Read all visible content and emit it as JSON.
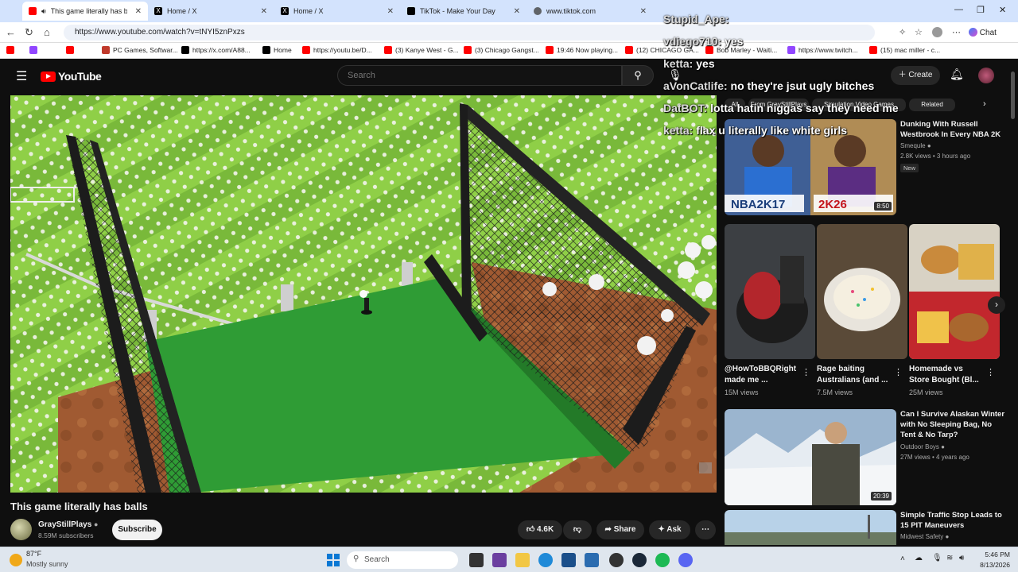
{
  "browser": {
    "tabs": [
      {
        "title": "This game literally has balls -",
        "icon": "youtube-icon",
        "active": true
      },
      {
        "title": "Home / X",
        "icon": "x-icon"
      },
      {
        "title": "Home / X",
        "icon": "x-icon"
      },
      {
        "title": "TikTok - Make Your Day",
        "icon": "tiktok-icon"
      },
      {
        "title": "www.tiktok.com",
        "icon": "globe-icon"
      }
    ],
    "url": "https://www.youtube.com/watch?v=tNYI5znPxzs",
    "chat_label": "Chat",
    "bookmarks": [
      {
        "label": "",
        "icon": "youtube-icon"
      },
      {
        "label": "",
        "icon": "twitch-icon"
      },
      {
        "label": "",
        "icon": "youtube-icon"
      },
      {
        "label": "PC Games, Softwar...",
        "icon": "game-icon"
      },
      {
        "label": "https://x.com/A88...",
        "icon": "x-icon"
      },
      {
        "label": "Home",
        "icon": "x-icon"
      },
      {
        "label": "https://youtu.be/D...",
        "icon": "youtube-icon"
      },
      {
        "label": "(3) Kanye West - G...",
        "icon": "youtube-icon"
      },
      {
        "label": "(3) Chicago Gangst...",
        "icon": "youtube-icon"
      },
      {
        "label": "19:46 Now playing...",
        "icon": "youtube-icon"
      },
      {
        "label": "(12) CHICAGO GA...",
        "icon": "youtube-icon"
      },
      {
        "label": "Bob Marley - Waiti...",
        "icon": "youtube-icon"
      },
      {
        "label": "https://www.twitch...",
        "icon": "twitch-icon"
      },
      {
        "label": "(15) mac miller - c...",
        "icon": "youtube-icon"
      }
    ]
  },
  "youtube": {
    "logo": "YouTube",
    "search_placeholder": "Search",
    "create_label": "Create",
    "video": {
      "title": "This game literally has balls",
      "channel": "GrayStillPlays",
      "subscribers": "8.59M subscribers",
      "subscribe_label": "Subscribe",
      "likes": "4.6K",
      "share_label": "Share",
      "ask_label": "Ask"
    },
    "chips": [
      "All",
      "From GrayStillPlays",
      "Simulation Video Games",
      "Related"
    ],
    "related": [
      {
        "title_line1": "Dunking With Russell",
        "title_line2": "Westbrook In Every NBA 2K",
        "channel": "Smequle",
        "meta": "2.8K views • 3 hours ago",
        "badge": "New",
        "duration": "8:50"
      },
      {
        "title_line1": "Can I Survive Alaskan Winter",
        "title_line2": "with No Sleeping Bag, No",
        "title_line3": "Tent & No Tarp?",
        "channel": "Outdoor Boys",
        "meta": "27M views • 4 years ago",
        "duration": "20:39"
      },
      {
        "title_line1": "Simple Traffic Stop Leads to",
        "title_line2": "15 PIT Maneuvers",
        "channel": "Midwest Safety"
      }
    ],
    "shorts": [
      {
        "title_line1": "@HowToBBQRight",
        "title_line2": "made me ...",
        "views": "15M views"
      },
      {
        "title_line1": "Rage baiting",
        "title_line2": "Australians (and ...",
        "views": "7.5M views"
      },
      {
        "title_line1": "Homemade vs",
        "title_line2": "Store Bought (Bl...",
        "views": "25M views"
      }
    ]
  },
  "chat_overlay": [
    {
      "user": "Stupid_Ape:",
      "message": ""
    },
    {
      "user": "vdiego710:",
      "message": "yes"
    },
    {
      "user": "ketta:",
      "message": "yes"
    },
    {
      "user": "aVonCatlife:",
      "message": "no they're jsut ugly bitches"
    },
    {
      "user": "DatBOT:",
      "message": "lotta hatin niggas say they need me"
    },
    {
      "user": "ketta:",
      "message": "flax u literally like white girls"
    }
  ],
  "taskbar": {
    "temperature": "87°F",
    "weather": "Mostly sunny",
    "search_placeholder": "Search",
    "time": "5:46 PM",
    "date": "8/13/2026"
  },
  "colors": {
    "youtube_red": "#ff0000",
    "yt_background": "#0f0f0f",
    "browser_chrome": "#d3e3fd"
  }
}
